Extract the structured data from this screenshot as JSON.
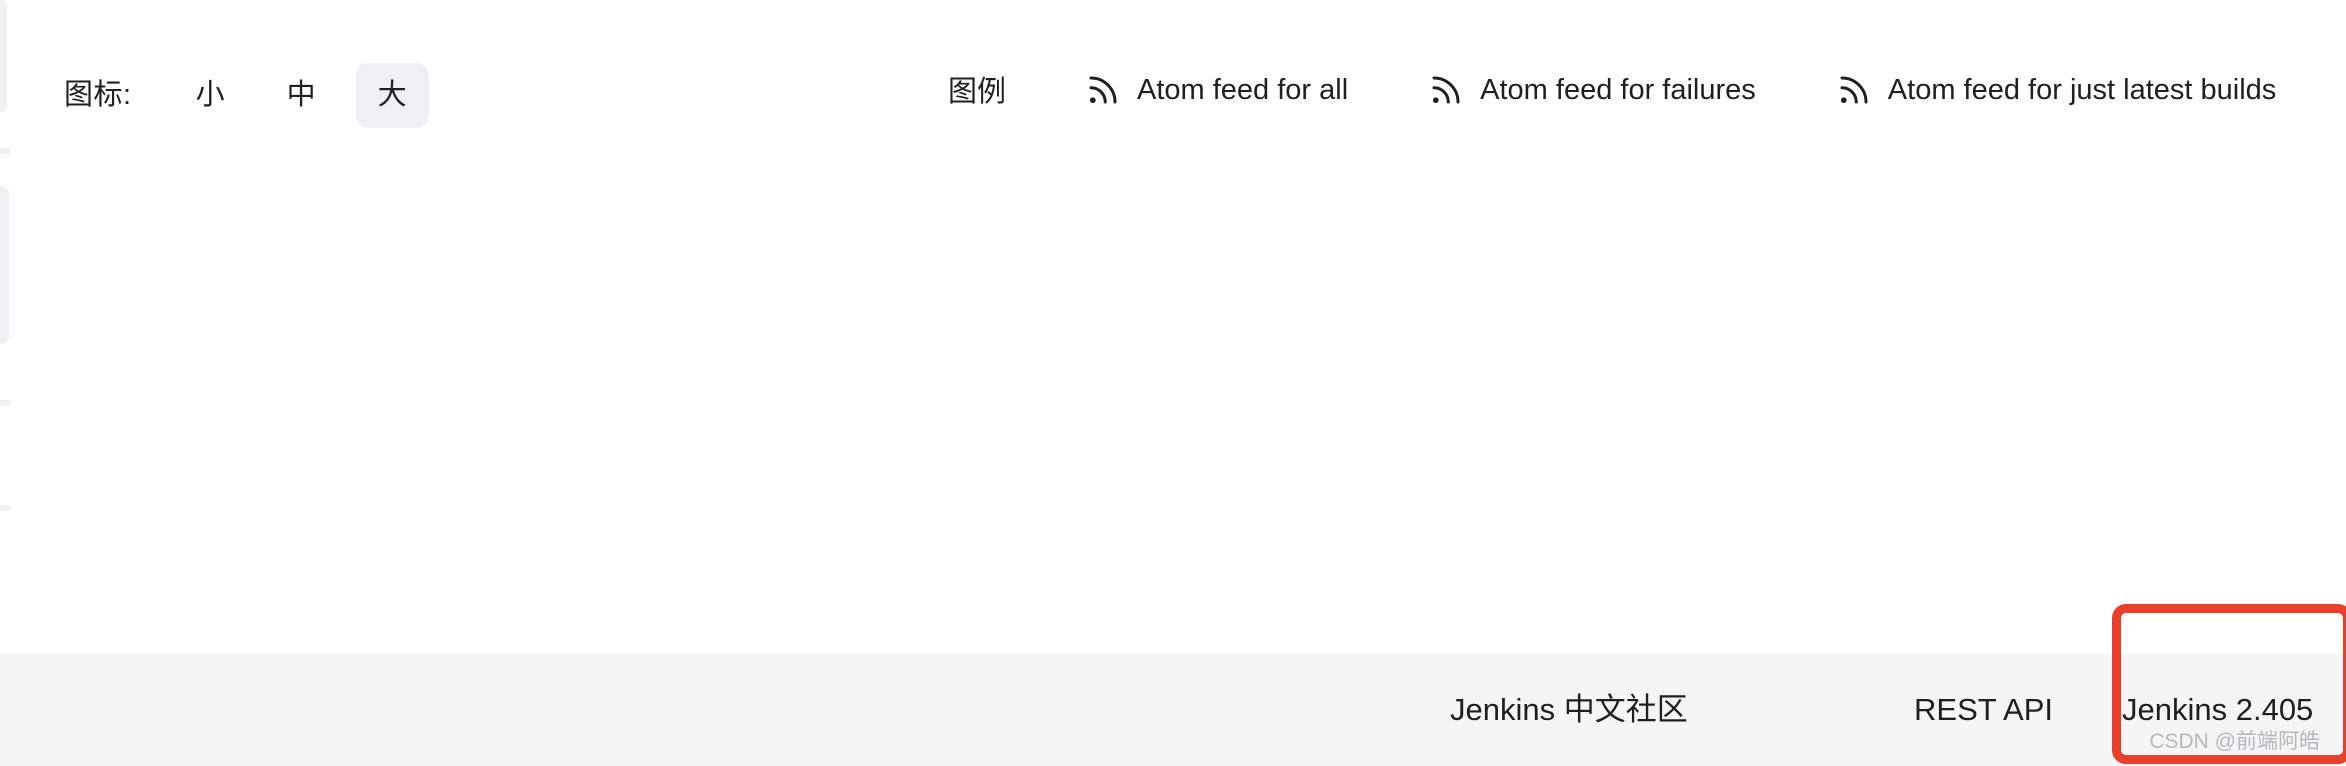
{
  "toolbar": {
    "icon_size": {
      "label": "图标:",
      "options": [
        {
          "label": "小",
          "active": false
        },
        {
          "label": "中",
          "active": false
        },
        {
          "label": "大",
          "active": true
        }
      ],
      "selected": "大"
    },
    "legend_label": "图例",
    "feeds": [
      {
        "icon": "rss-icon",
        "label": "Atom feed for all"
      },
      {
        "icon": "rss-icon",
        "label": "Atom feed for failures"
      },
      {
        "icon": "rss-icon",
        "label": "Atom feed for just latest builds"
      }
    ]
  },
  "footer": {
    "links": [
      {
        "label": "Jenkins 中文社区"
      },
      {
        "label": "REST API"
      },
      {
        "label": "Jenkins 2.405"
      }
    ],
    "community_label": "Jenkins 中文社区",
    "rest_api_label": "REST API",
    "version_label": "Jenkins 2.405"
  },
  "annotation": {
    "highlight_color": "#e8402a",
    "target": "Jenkins 2.405"
  },
  "watermark": {
    "text": "CSDN @前端阿皓"
  },
  "colors": {
    "page_background": "#ffffff",
    "footer_background": "#f4f5f7",
    "active_chip_background": "#eff0f4",
    "text": "#1f1f23",
    "watermark_text": "#b6b8bd",
    "annotation_red": "#e8402a"
  }
}
